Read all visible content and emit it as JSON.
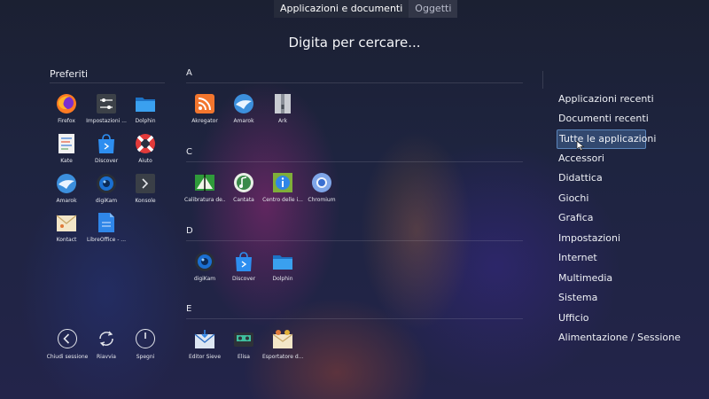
{
  "tabs": {
    "apps": "Applicazioni e documenti",
    "items": "Oggetti"
  },
  "search": {
    "placeholder": "Digita per cercare..."
  },
  "favorites": {
    "title": "Preferiti",
    "apps": [
      {
        "label": "Firefox"
      },
      {
        "label": "Impostazioni ..."
      },
      {
        "label": "Dolphin"
      },
      {
        "label": "Kate"
      },
      {
        "label": "Discover"
      },
      {
        "label": "Aiuto"
      },
      {
        "label": "Amarok"
      },
      {
        "label": "digiKam"
      },
      {
        "label": "Konsole"
      },
      {
        "label": "Kontact"
      },
      {
        "label": "LibreOffice - ..."
      }
    ]
  },
  "sections": [
    {
      "letter": "A",
      "apps": [
        {
          "label": "Akregator"
        },
        {
          "label": "Amarok"
        },
        {
          "label": "Ark"
        }
      ]
    },
    {
      "letter": "C",
      "apps": [
        {
          "label": "Calibratura de..."
        },
        {
          "label": "Cantata"
        },
        {
          "label": "Centro delle i..."
        },
        {
          "label": "Chromium"
        }
      ]
    },
    {
      "letter": "D",
      "apps": [
        {
          "label": "digiKam"
        },
        {
          "label": "Discover"
        },
        {
          "label": "Dolphin"
        }
      ]
    },
    {
      "letter": "E",
      "apps": [
        {
          "label": "Editor Sieve"
        },
        {
          "label": "Elisa"
        },
        {
          "label": "Esportatore d..."
        }
      ]
    }
  ],
  "power": [
    {
      "label": "Chiudi sessione"
    },
    {
      "label": "Riavvia"
    },
    {
      "label": "Spegni"
    }
  ],
  "categories": [
    {
      "label": "Applicazioni recenti"
    },
    {
      "label": "Documenti recenti"
    },
    {
      "label": "Tutte le applicazioni"
    },
    {
      "label": "Accessori"
    },
    {
      "label": "Didattica"
    },
    {
      "label": "Giochi"
    },
    {
      "label": "Grafica"
    },
    {
      "label": "Impostazioni"
    },
    {
      "label": "Internet"
    },
    {
      "label": "Multimedia"
    },
    {
      "label": "Sistema"
    },
    {
      "label": "Ufficio"
    },
    {
      "label": "Alimentazione / Sessione"
    }
  ]
}
